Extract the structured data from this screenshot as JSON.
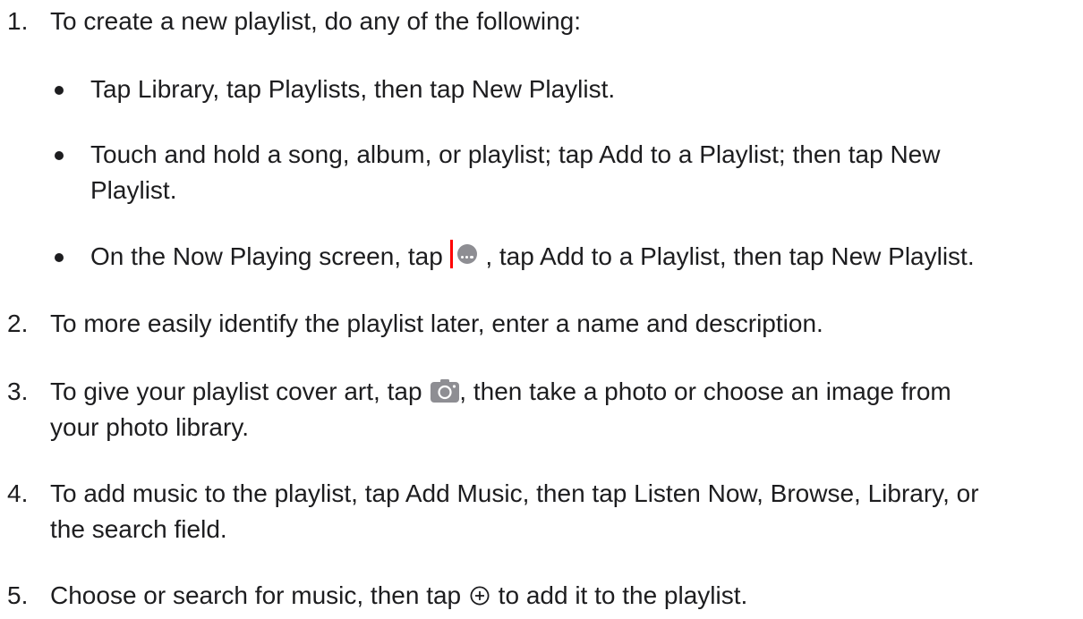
{
  "steps": [
    {
      "number": "1.",
      "text": "To create a new playlist, do any of the following:"
    },
    {
      "number": "2.",
      "text": "To more easily identify the playlist later, enter a name and description."
    },
    {
      "number": "3.",
      "text_before": "To give your playlist cover art, tap ",
      "text_after_line1": ", then take a photo or choose an image from",
      "text_line2": "your photo library."
    },
    {
      "number": "4.",
      "text_line1": "To add music to the playlist, tap Add Music, then tap Listen Now, Browse, Library, or",
      "text_line2": "the search field."
    },
    {
      "number": "5.",
      "text_before": "Choose or search for music, then tap ",
      "text_after": " to add it to the playlist."
    }
  ],
  "sub_items": [
    {
      "text": "Tap Library, tap Playlists, then tap New Playlist."
    },
    {
      "text_line1": "Touch and hold a song, album, or playlist; tap Add to a Playlist; then tap New",
      "text_line2": "Playlist."
    },
    {
      "text_before": "On the Now Playing screen, tap ",
      "text_after": " , tap Add to a Playlist, then tap New Playlist."
    }
  ],
  "icons": {
    "more": "more-button-icon",
    "camera": "camera-icon",
    "add": "add-circle-icon"
  },
  "colors": {
    "text": "#1d1d1f",
    "icon_gray": "#8e8e93",
    "cursor_red": "#ff0000"
  }
}
